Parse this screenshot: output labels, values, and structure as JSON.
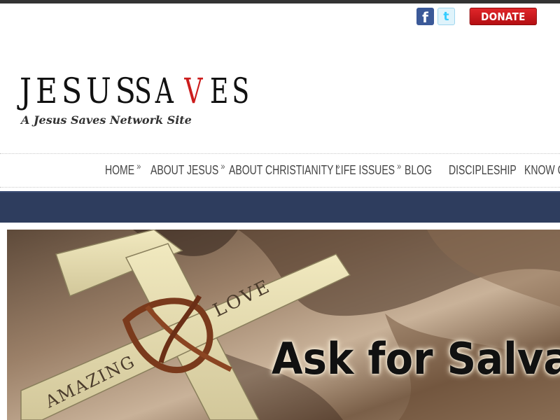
{
  "header": {
    "social": {
      "facebook_glyph": "f",
      "twitter_glyph": "t"
    },
    "donate_label": "DONATE",
    "logo": {
      "word1": "JESUS",
      "word2_start": "SA",
      "word2_cross": "V",
      "word2_end": "ES"
    },
    "tagline": "A Jesus Saves Network Site"
  },
  "nav": {
    "items": [
      {
        "label": "HOME",
        "submenu": "»"
      },
      {
        "label": "ABOUT JESUS",
        "submenu": "»"
      },
      {
        "label": "ABOUT CHRISTIANITY",
        "submenu": "»"
      },
      {
        "label": "LIFE ISSUES",
        "submenu": "»"
      },
      {
        "label": "BLOG"
      },
      {
        "label": "DISCIPLESHIP"
      },
      {
        "label": "KNOW GO"
      }
    ]
  },
  "banner": {
    "title": "Ask for Salvat",
    "cross_words": {
      "top": "LOVE",
      "bottom": "AMAZING"
    }
  },
  "colors": {
    "top_bar": "#333333",
    "nav_bar": "#2e3d5e",
    "donate": "#c8151a",
    "logo_accent": "#cc1d1d",
    "facebook": "#3b5998",
    "twitter": "#33ccff"
  },
  "icons": [
    "facebook-icon",
    "twitter-icon",
    "submenu-arrow-icon"
  ]
}
